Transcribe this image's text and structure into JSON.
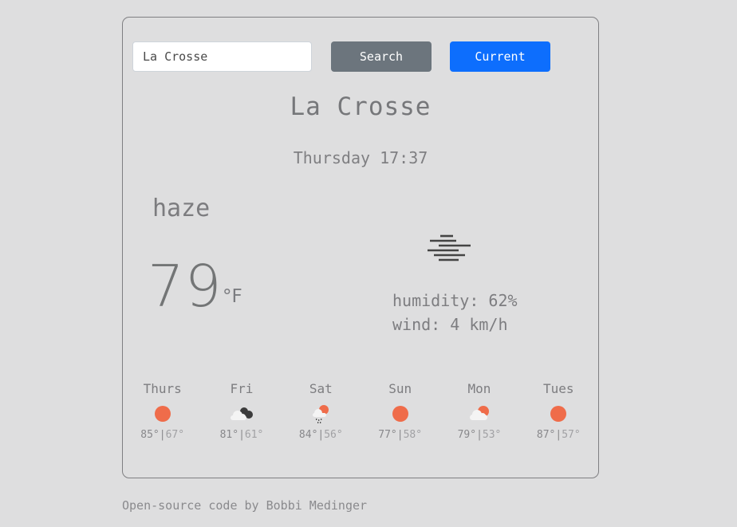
{
  "search": {
    "value": "La Crosse",
    "search_label": "Search",
    "current_label": "Current"
  },
  "current": {
    "city": "La Crosse",
    "datetime": "Thursday 17:37",
    "description": "haze",
    "temperature": "79",
    "unit": "°F",
    "icon": "haze-icon",
    "humidity": "humidity: 62%",
    "wind": "wind: 4 km/h"
  },
  "forecast": [
    {
      "day": "Thurs",
      "icon": "sun-icon",
      "high": "85°",
      "low": "67°"
    },
    {
      "day": "Fri",
      "icon": "broken-clouds-icon",
      "high": "81°",
      "low": "61°"
    },
    {
      "day": "Sat",
      "icon": "rain-sun-icon",
      "high": "84°",
      "low": "56°"
    },
    {
      "day": "Sun",
      "icon": "sun-icon",
      "high": "77°",
      "low": "58°"
    },
    {
      "day": "Mon",
      "icon": "partly-cloudy-icon",
      "high": "79°",
      "low": "53°"
    },
    {
      "day": "Tues",
      "icon": "sun-icon",
      "high": "87°",
      "low": "57°"
    }
  ],
  "colors": {
    "sun": "#ef6c4a",
    "cloud": "#f4f4f4",
    "dark_cloud": "#3c3c3c",
    "search_btn": "#6c757d",
    "current_btn": "#0d6efd"
  },
  "footer": {
    "text": "Open-source code by Bobbi Medinger"
  }
}
